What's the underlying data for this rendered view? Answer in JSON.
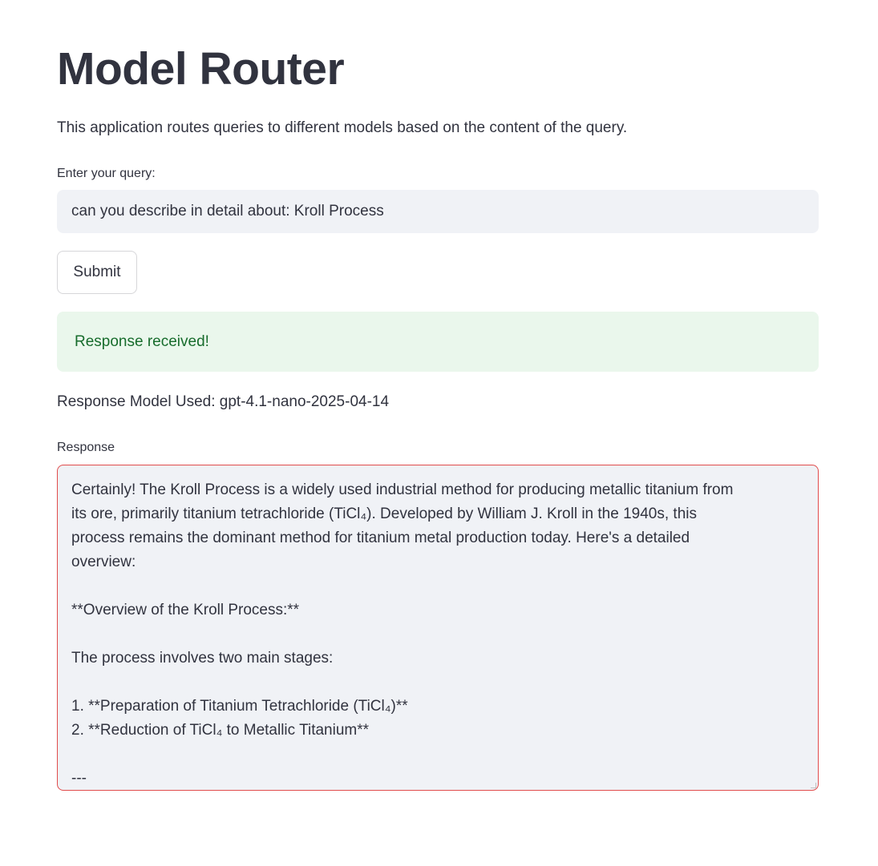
{
  "page": {
    "title": "Model Router",
    "description": "This application routes queries to different models based on the content of the query."
  },
  "query": {
    "label": "Enter your query:",
    "value": "can you describe in detail about: Kroll Process"
  },
  "submit": {
    "label": "Submit"
  },
  "alert": {
    "text": "Response received!"
  },
  "model": {
    "text": "Response Model Used: gpt-4.1-nano-2025-04-14"
  },
  "response": {
    "label": "Response",
    "lines": [
      "Certainly! The Kroll Process is a widely used industrial method for producing metallic titanium from",
      "its ore, primarily titanium tetrachloride (TiCl₄). Developed by William J. Kroll in the 1940s, this",
      "process remains the dominant method for titanium metal production today. Here's a detailed",
      "overview:",
      "",
      "**Overview of the Kroll Process:**",
      "",
      "The process involves two main stages:",
      "",
      "1. **Preparation of Titanium Tetrachloride (TiCl₄)**",
      "2. **Reduction of TiCl₄ to Metallic Titanium**",
      "",
      "---"
    ]
  },
  "colors": {
    "input_bg": "#f0f2f6",
    "success_bg": "#eaf7ec",
    "success_text": "#176c2c",
    "error_border": "#e14c4c",
    "text": "#31333f"
  }
}
